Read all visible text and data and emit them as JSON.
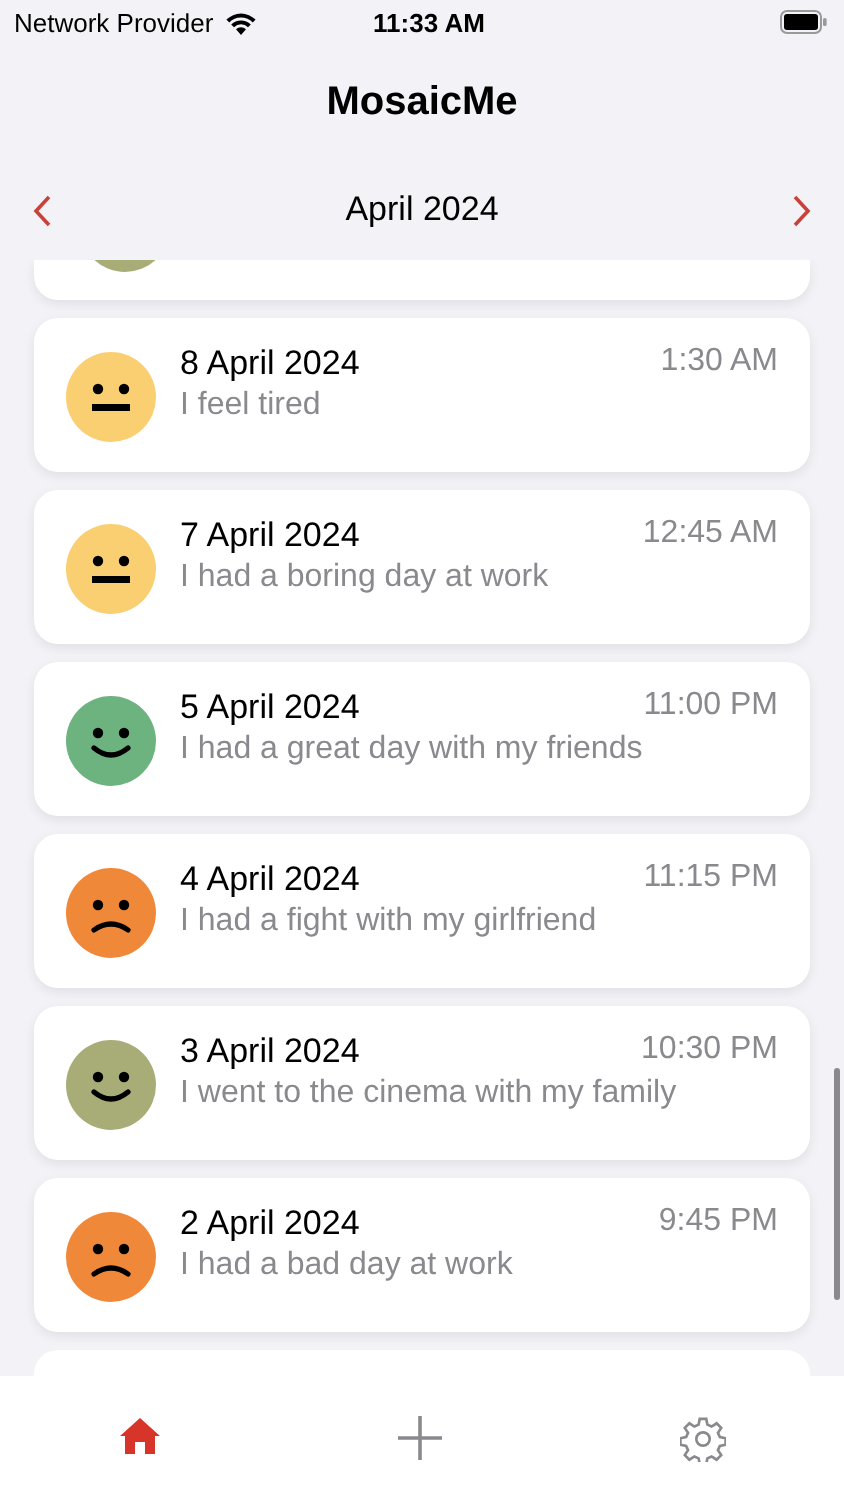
{
  "status_bar": {
    "carrier": "Network Provider",
    "time": "11:33 AM"
  },
  "title": "MosaicMe",
  "month_nav": {
    "label": "April 2024"
  },
  "partial_top_entry": {
    "color": "#a8ad78"
  },
  "entries": [
    {
      "date": "8 April 2024",
      "time": "1:30 AM",
      "note": "I feel tired",
      "kind": "neutral",
      "color": "#f9cf72"
    },
    {
      "date": "7 April 2024",
      "time": "12:45 AM",
      "note": "I had a boring day at work",
      "kind": "neutral",
      "color": "#f9cf72"
    },
    {
      "date": "5 April 2024",
      "time": "11:00 PM",
      "note": "I had a great day with my friends",
      "kind": "smile",
      "color": "#6db37f"
    },
    {
      "date": "4 April 2024",
      "time": "11:15 PM",
      "note": "I had a fight with my girlfriend",
      "kind": "frown",
      "color": "#f0883a"
    },
    {
      "date": "3 April 2024",
      "time": "10:30 PM",
      "note": "I went to the cinema with my family",
      "kind": "smile",
      "color": "#a8ad78"
    },
    {
      "date": "2 April 2024",
      "time": "9:45 PM",
      "note": "I had a bad day at work",
      "kind": "frown",
      "color": "#f0883a"
    }
  ],
  "tab_bar": [
    {
      "kind": "home",
      "selected": true
    },
    {
      "kind": "add",
      "selected": false
    },
    {
      "kind": "settings",
      "selected": false
    }
  ]
}
